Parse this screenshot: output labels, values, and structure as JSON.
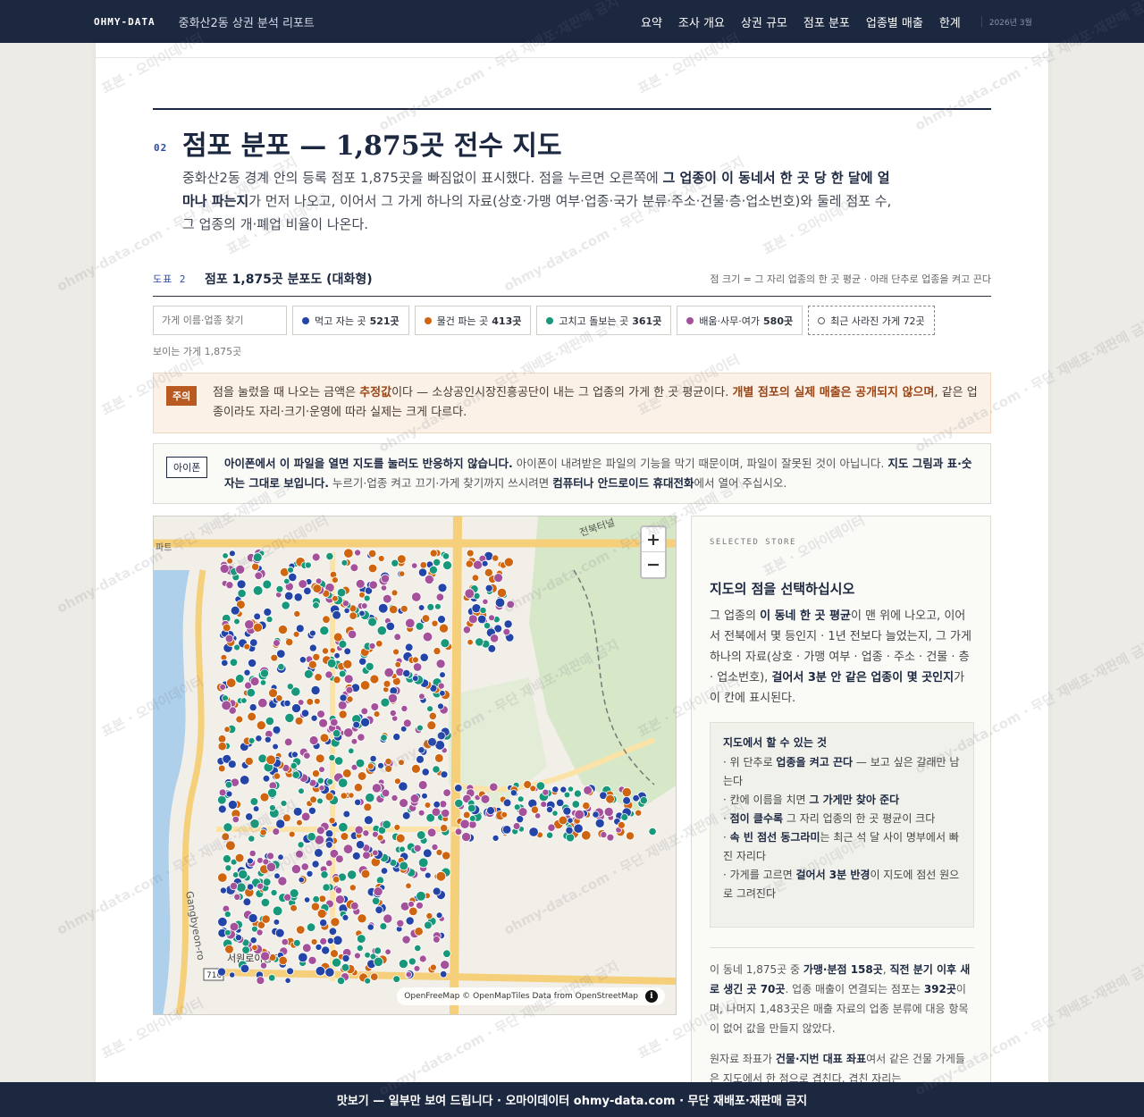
{
  "nav": {
    "brand": "OHMY-DATA",
    "report_title": "중화산2동 상권 분석 리포트",
    "items": [
      {
        "label": "요약"
      },
      {
        "label": "조사 개요"
      },
      {
        "label": "상권 규모"
      },
      {
        "label": "점포 분포"
      },
      {
        "label": "업종별 매출"
      },
      {
        "label": "한계"
      }
    ],
    "date": "2026년 3월"
  },
  "section": {
    "number": "02",
    "title": "점포 분포 — 1,875곳 전수 지도",
    "intro_a": "중화산2동 경계 안의 등록 점포 1,875곳을 빠짐없이 표시했다. 점을 누르면 오른쪽에 ",
    "intro_b": "그 업종이 이 동네서 한 곳 당 한 달에 얼마나 파는지",
    "intro_c": "가 먼저 나오고, 이어서 그 가게 하나의 자료(상호·가맹 여부·업종·국가 분류·주소·건물·층·업소번호)와 둘레 점포 수, 그 업종의 개·폐업 비율이 나온다."
  },
  "figure": {
    "label": "도표 2",
    "title": "점포 1,875곳 분포도 (대화형)",
    "note": "점 크기 = 그 자리 업종의 한 곳 평균 · 아래 단추로 업종을 켜고 끈다"
  },
  "filters": {
    "search_placeholder": "가게 이름·업종 찾기",
    "chips": [
      {
        "label": "먹고 자는 곳",
        "count": "521곳",
        "color": "#2445a8"
      },
      {
        "label": "물건 파는 곳",
        "count": "413곳",
        "color": "#d0650f"
      },
      {
        "label": "고치고 돌보는 곳",
        "count": "361곳",
        "color": "#18987a"
      },
      {
        "label": "배움·사무·여가",
        "count": "580곳",
        "color": "#a4509a"
      }
    ],
    "closed_label": "최근 사라진 가게 72곳",
    "visible_count": "보이는 가게 1,875곳"
  },
  "notice": {
    "badge": "주의",
    "text_a": "점을 눌렀을 때 나오는 금액은 ",
    "text_b": "추정값",
    "text_c": "이다 — 소상공인시장진흥공단이 내는 그 업종의 가게 한 곳 평균이다. ",
    "text_d": "개별 점포의 실제 매출은 공개되지 않으며",
    "text_e": ", 같은 업종이라도 자리·크기·운영에 따라 실제는 크게 다르다."
  },
  "iphone": {
    "badge": "아이폰",
    "text_a": "아이폰에서 이 파일을 열면 지도를 눌러도 반응하지 않습니다.",
    "text_b": " 아이폰이 내려받은 파일의 기능을 막기 때문이며, 파일이 잘못된 것이 아닙니다. ",
    "text_c": "지도 그림과 표·숫자는 그대로 보입니다.",
    "text_d": " 누르기·업종 켜고 끄기·가게 찾기까지 쓰시려면 ",
    "text_e": "컴퓨터나 안드로이드 휴대전화",
    "text_f": "에서 열어 주십시오."
  },
  "map": {
    "zoom_in": "+",
    "zoom_out": "−",
    "attribution": "OpenFreeMap © OpenMapTiles Data from OpenStreetMap",
    "info": "i",
    "labels": {
      "tunnel": "전북터널",
      "road_west": "Gangbyeon-ro",
      "bridge": "서원로이동교",
      "route": "716",
      "apt": "파트"
    }
  },
  "panel": {
    "kicker": "SELECTED STORE",
    "title": "지도의 점을 선택하십시오",
    "desc_a": "그 업종의 ",
    "desc_b": "이 동네 한 곳 평균",
    "desc_c": "이 맨 위에 나오고, 이어서 전북에서 몇 등인지 · 1년 전보다 늘었는지, 그 가게 하나의 자료(상호 · 가맹 여부 · 업종 · 주소 · 건물 · 층 · 업소번호), ",
    "desc_d": "걸어서 3분 안 같은 업종이 몇 곳인지",
    "desc_e": "가 이 칸에 표시된다.",
    "howto_title": "지도에서 할 수 있는 것",
    "howto_1a": "· 위 단추로 ",
    "howto_1b": "업종을 켜고 끈다",
    "howto_1c": " — 보고 싶은 갈래만 남는다",
    "howto_2a": "· 칸에 이름을 치면 ",
    "howto_2b": "그 가게만 찾아 준다",
    "howto_3a": "· ",
    "howto_3b": "점이 클수록",
    "howto_3c": " 그 자리 업종의 한 곳 평균이 크다",
    "howto_4a": "· ",
    "howto_4b": "속 빈 점선 동그라미",
    "howto_4c": "는 최근 석 달 사이 명부에서 빠진 자리다",
    "howto_5a": "· 가게를 고르면 ",
    "howto_5b": "걸어서 3분 반경",
    "howto_5c": "이 지도에 점선 원으로 그려진다",
    "stat_a": "이 동네 1,875곳 중 ",
    "stat_b": "가맹·분점 158곳",
    "stat_c": ", ",
    "stat_d": "직전 분기 이후 새로 생긴 곳 70곳",
    "stat_e": ". 업종 매출이 연결되는 점포는 ",
    "stat_f": "392곳",
    "stat_g": "이며, 나머지 1,483곳은 매출 자료의 업종 분류에 대응 항목이 없어 값을 만들지 않았다.",
    "more_a": "원자료 좌표가 ",
    "more_b": "건물·지번 대표 좌표",
    "more_c": "여서 같은 건물 가게들은 지도에서 한 점으로 겹친다. 겹친 자리는"
  },
  "footer": {
    "text": "맛보기 — 일부만 보여 드립니다 · 오마이데이터 ohmy-data.com · 무단 재배포·재판매 금지"
  },
  "watermark": {
    "a": "표본 · 오마이데이터",
    "b": "ohmy-data.com · 무단 재배포·재판매 금지"
  }
}
